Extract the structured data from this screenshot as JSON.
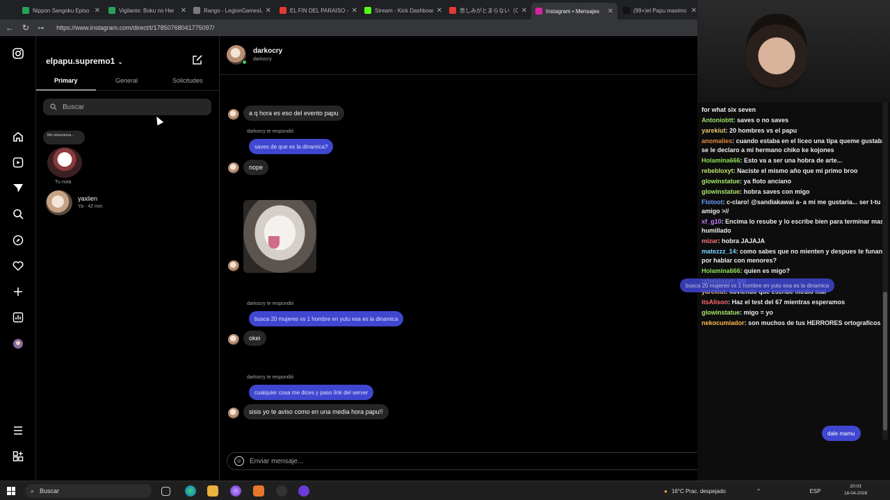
{
  "browser": {
    "tabs": [
      {
        "title": "Nippon Sangoku Episo",
        "color": "#25a35a",
        "active": false
      },
      {
        "title": "Vigilante: Boku no Her",
        "color": "#25a35a",
        "active": false
      },
      {
        "title": "Rango - LegionGamesU",
        "color": "#7a7a7a",
        "active": false
      },
      {
        "title": "EL FIN DEL PARAISO - m",
        "color": "#e53935",
        "active": false
      },
      {
        "title": "Stream - Kick Dashboar",
        "color": "#53fc18",
        "active": false
      },
      {
        "title": "悲しみがとまらない（CA",
        "color": "#e53935",
        "active": false
      },
      {
        "title": "Instagram • Mensajes",
        "color": "#d6249f",
        "active": true
      },
      {
        "title": "(99+)el Papu maximo (6",
        "color": "#111111",
        "active": false
      }
    ],
    "url": "https://www.instagram.com/direct/t/17850768041775097/"
  },
  "inbox": {
    "username": "elpapu.supremo1",
    "tabs": [
      "Primary",
      "General",
      "Solicitudes"
    ],
    "search_placeholder": "Buscar",
    "note_text": "Me obsesiona...",
    "note_label": "Tu nota",
    "conversations": [
      {
        "name": "yaxlien",
        "sub": "Ya · 42 min"
      }
    ]
  },
  "chat": {
    "name": "darkocry",
    "handle": "darkocry",
    "messages": [
      {
        "type": "in",
        "text": "a q hora es eso del evento papu"
      },
      {
        "type": "reply",
        "text": "darkocry te respondió"
      },
      {
        "type": "out",
        "text": "saves de que es la dinamica?"
      },
      {
        "type": "in",
        "text": "nope"
      },
      {
        "type": "reply",
        "text": "darkocry te respondió"
      },
      {
        "type": "out",
        "text": "busca 20 mujeres vs 1 hombre en yutu esa es la dinamica"
      },
      {
        "type": "in",
        "text": "okei"
      },
      {
        "type": "reply",
        "text": "darkocry te respondió"
      },
      {
        "type": "out",
        "text": "cualquier cosa me dices y paso link del server"
      },
      {
        "type": "in",
        "text": "sisis yo te aviso como en una media hora papu!!"
      }
    ],
    "composer_placeholder": "Enviar mensaje..."
  },
  "stream_chat": {
    "messages": [
      {
        "user": "",
        "color": "#ffffff",
        "text": "for what six seven"
      },
      {
        "user": "Antoniobtt",
        "color": "#9be26a",
        "text": ": saves o no saves"
      },
      {
        "user": "yarekiut",
        "color": "#e8c86b",
        "text": ": 20 hombres vs el papu"
      },
      {
        "user": "anomalies",
        "color": "#e08a3c",
        "text": ": cuando estaba en el liceo una tipa queme gustaba se le declaro a mi hermano chiko ke kojones"
      },
      {
        "user": "Holamina666",
        "color": "#8fe05a",
        "text": ": Esto va a ser una hobra de arte..."
      },
      {
        "user": "rebebloxyt",
        "color": "#bde36b",
        "text": ": Naciste el mismo año que mi primo broo"
      },
      {
        "user": "glowinstatue",
        "color": "#a6e86b",
        "text": ": ya floto anciano"
      },
      {
        "user": "glowinstatue",
        "color": "#a6e86b",
        "text": ": hobra saves con migo"
      },
      {
        "user": "Flotoot",
        "color": "#6b9bff",
        "text": ": c-claro! @sandiakawai a- a mi me gustaria... ser t-tu amigo >//"
      },
      {
        "user": "xf_g10",
        "color": "#c77dff",
        "text": ": Encima lo resube y lo escribe bien para terminar mas humillado"
      },
      {
        "user": "mizar",
        "color": "#ff7070",
        "text": ": hobra JAJAJA"
      },
      {
        "user": "matezzz_14",
        "color": "#7ad3ff",
        "text": ": como sabes que no mienten y despues te funan por hablar con menores?"
      },
      {
        "user": "Holamina666",
        "color": "#8fe05a",
        "text": ": quien es migo?"
      },
      {
        "user": "rebebloxyt",
        "color": "#bde36b",
        "text": ": Siii"
      },
      {
        "user": "yarekiut",
        "color": "#e8c86b",
        "text": ": lloviendo que escribe medio mal"
      },
      {
        "user": "itsAlison",
        "color": "#ff6b6b",
        "text": ": Haz el test del 67 mientras esperamos"
      },
      {
        "user": "glowinstatue",
        "color": "#a6e86b",
        "text": ": migo = yo"
      },
      {
        "user": "nekocumiador",
        "color": "#ffb84d",
        "text": ": son muchos de tus HERRORES ortograficos"
      }
    ],
    "reply_preview": "busca 20 mujeres vs 1 hombre en yutu esa es la dinamica",
    "sent_bubble": "dale mamu"
  },
  "taskbar": {
    "search": "Buscar",
    "weather": "16°C  Prac. despejado",
    "lang": "ESP",
    "time": "20:03",
    "date": "18-04-2026"
  }
}
